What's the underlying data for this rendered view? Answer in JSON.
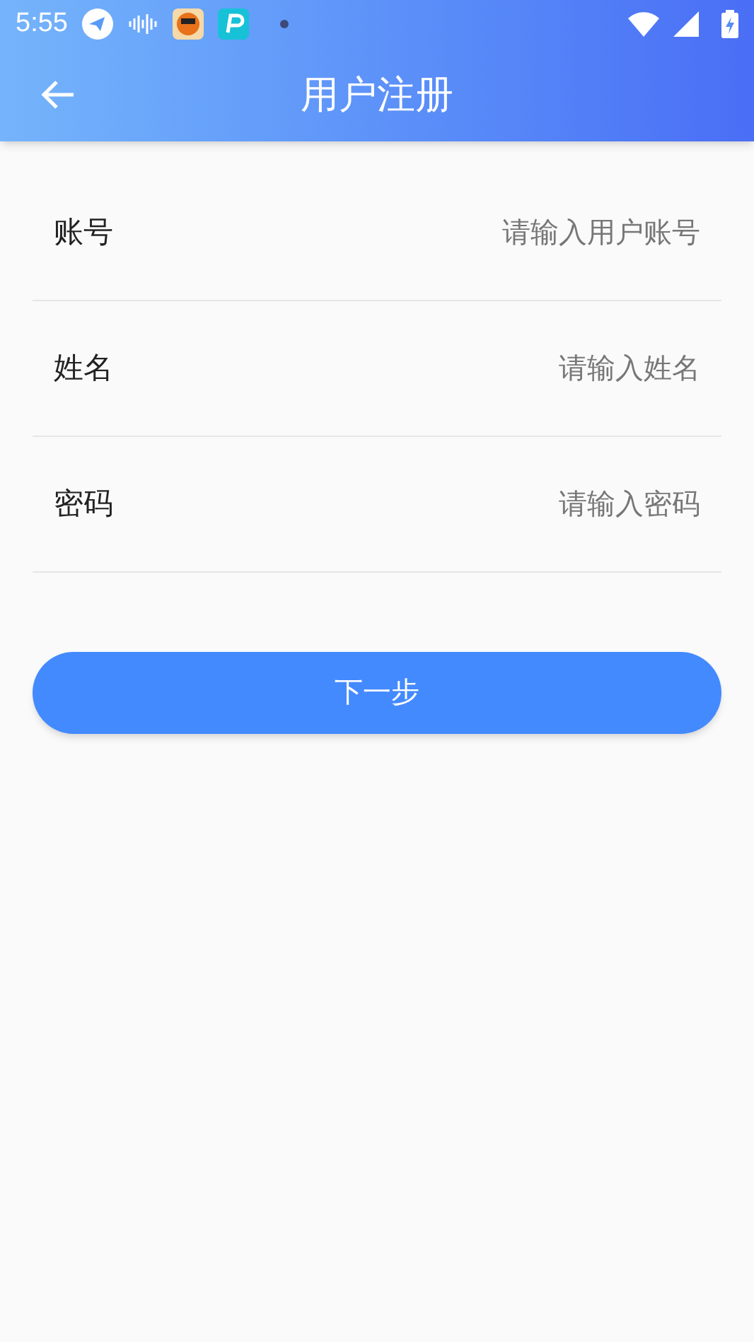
{
  "status_bar": {
    "time": "5:55"
  },
  "header": {
    "title": "用户注册"
  },
  "fields": [
    {
      "label": "账号",
      "placeholder": "请输入用户账号"
    },
    {
      "label": "姓名",
      "placeholder": "请输入姓名"
    },
    {
      "label": "密码",
      "placeholder": "请输入密码"
    }
  ],
  "next_button": "下一步"
}
